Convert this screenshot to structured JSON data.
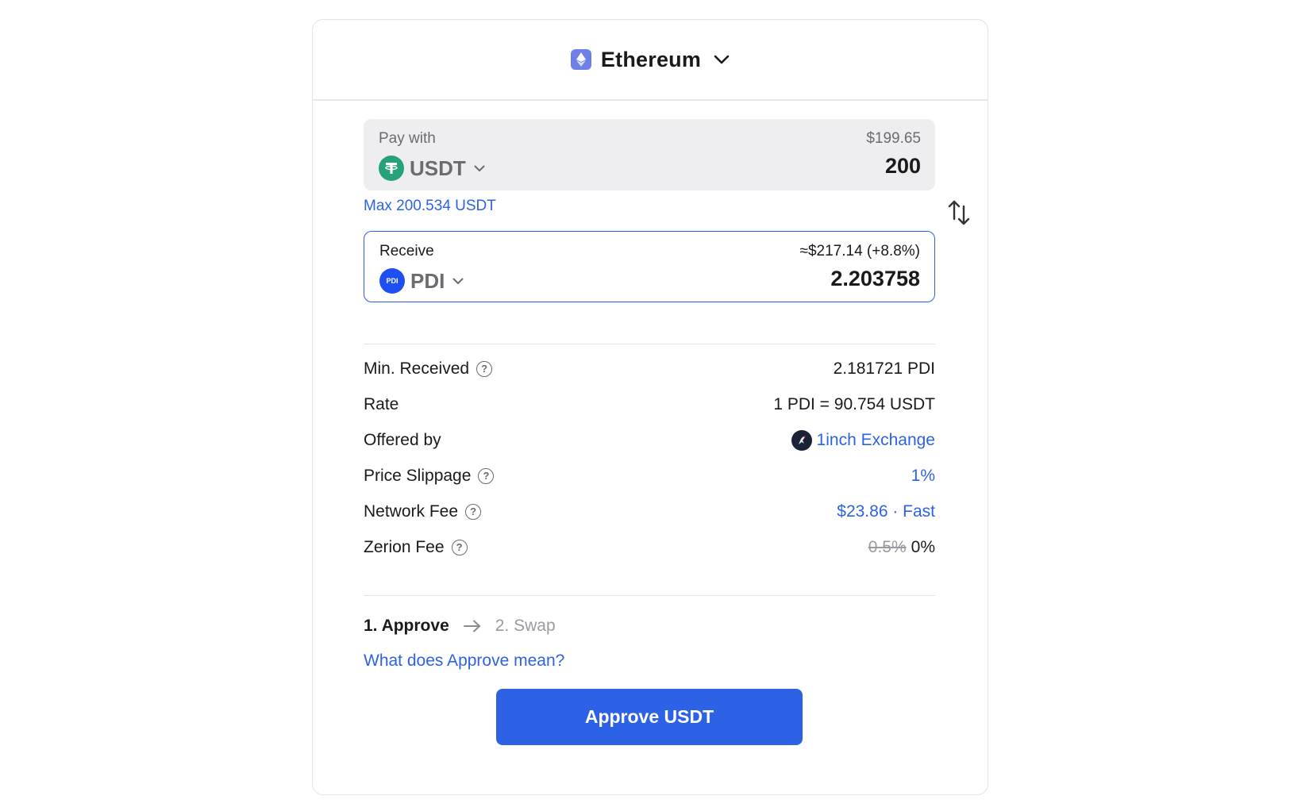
{
  "network": {
    "name": "Ethereum",
    "icon": "ethereum-icon"
  },
  "pay": {
    "label": "Pay with",
    "token": "USDT",
    "token_icon": "usdt-icon",
    "usd_value": "$199.65",
    "amount": "200",
    "max_text": "Max 200.534 USDT"
  },
  "receive": {
    "label": "Receive",
    "token": "PDI",
    "token_icon": "pdi-icon",
    "token_icon_text": "PDI",
    "usd_value": "≈$217.14 (+8.8%)",
    "amount": "2.203758"
  },
  "details": [
    {
      "label": "Min. Received",
      "value": "2.181721 PDI",
      "help": true
    },
    {
      "label": "Rate",
      "value": "1 PDI = 90.754 USDT",
      "help": false
    },
    {
      "label": "Offered by",
      "value": "1inch Exchange",
      "help": false
    },
    {
      "label": "Price Slippage",
      "value": "1%",
      "help": true
    },
    {
      "label": "Network Fee",
      "value": "$23.86 · Fast",
      "help": true
    },
    {
      "label": "Zerion Fee",
      "value_old": "0.5%",
      "value": "0%",
      "help": true
    }
  ],
  "steps": {
    "step1": "1. Approve",
    "step2": "2. Swap",
    "help_link": "What does Approve mean?"
  },
  "approve_button": "Approve USDT",
  "colors": {
    "accent": "#2e62e6",
    "usdt": "#26a17b",
    "pdi": "#1d4ff2",
    "ethereum": "#6f7fe8"
  }
}
